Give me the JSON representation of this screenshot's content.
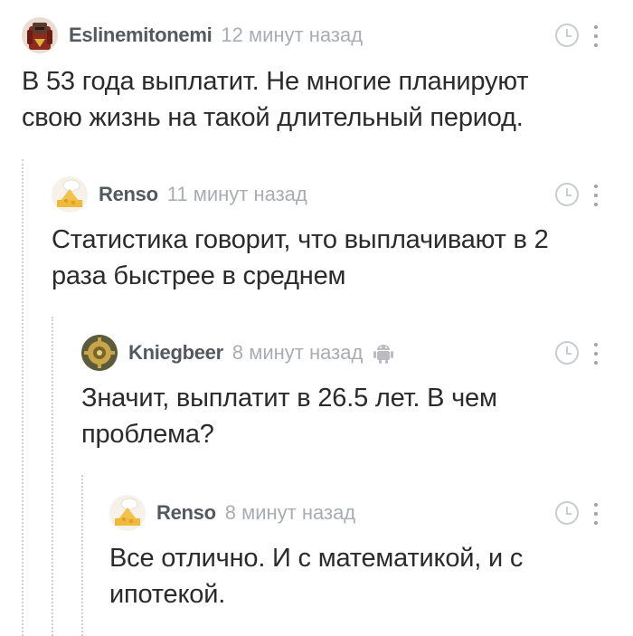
{
  "comments": [
    {
      "author": "Eslinemitonemi",
      "time": "12 минут назад",
      "avatar_icon": "knight-avatar",
      "text": "В 53 года выплатит. Не многие планируют свою жизнь на такой длительный период."
    },
    {
      "author": "Renso",
      "time": "11 минут назад",
      "avatar_icon": "cheese-chef-avatar",
      "text": "Статистика говорит, что выплачивают в 2 раза быстрее в среднем"
    },
    {
      "author": "Kniegbeer",
      "time": "8 минут назад",
      "avatar_icon": "gear-avatar",
      "device_icon": "android-icon",
      "text": "Значит, выплатит в 26.5 лет. В чем проблема?"
    },
    {
      "author": "Renso",
      "time": "8 минут назад",
      "avatar_icon": "cheese-chef-avatar",
      "text": "Все отлично. И с математикой, и с ипотекой."
    }
  ],
  "colors": {
    "author": "#53595f",
    "time": "#a9adb1",
    "icon": "#c9ccd0",
    "thread_line": "#cfcfcf"
  }
}
